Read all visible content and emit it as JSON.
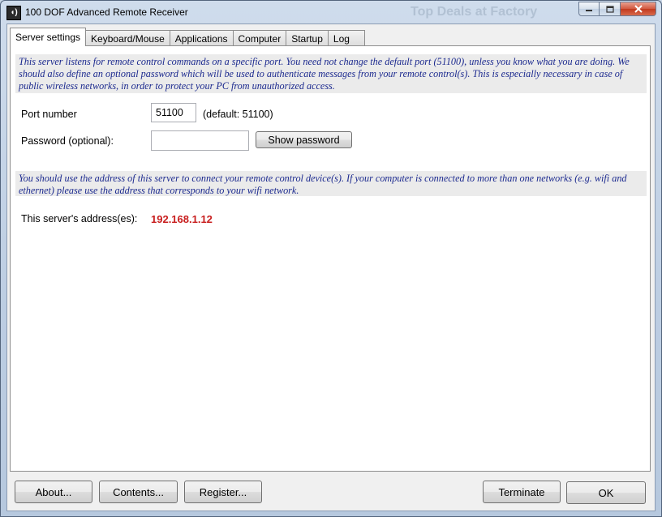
{
  "window": {
    "title": "100 DOF Advanced Remote Receiver",
    "background_text": "Top Deals at Factory",
    "icon": "speaker-waves-icon"
  },
  "tabs": [
    {
      "label": "Server settings"
    },
    {
      "label": "Keyboard/Mouse"
    },
    {
      "label": "Applications"
    },
    {
      "label": "Computer"
    },
    {
      "label": "Startup"
    },
    {
      "label": "Log"
    }
  ],
  "server": {
    "intro": "This server listens for remote control commands on a specific port. You need not change the default port (51100), unless you know what you are doing. We should also define an optional password which will be used to authenticate messages from your remote control(s). This is especially necessary in case of public wireless networks, in order to protect your PC from unauthorized access.",
    "port_label": "Port number",
    "port_value": "51100",
    "port_default": "(default: 51100)",
    "password_label": "Password (optional):",
    "password_value": "",
    "show_password_label": "Show password",
    "address_info": "You should use the address of this server to connect your remote control device(s). If your computer is connected to more than one networks (e.g. wifi and ethernet) please use the address that corresponds to your wifi network.",
    "address_label": "This server's address(es):",
    "address_value": "192.168.1.12"
  },
  "footer": {
    "about_label": "About...",
    "contents_label": "Contents...",
    "register_label": "Register...",
    "terminate_label": "Terminate",
    "ok_label": "OK"
  },
  "colors": {
    "info_text": "#1c2a8f",
    "address": "#c81e1e"
  }
}
